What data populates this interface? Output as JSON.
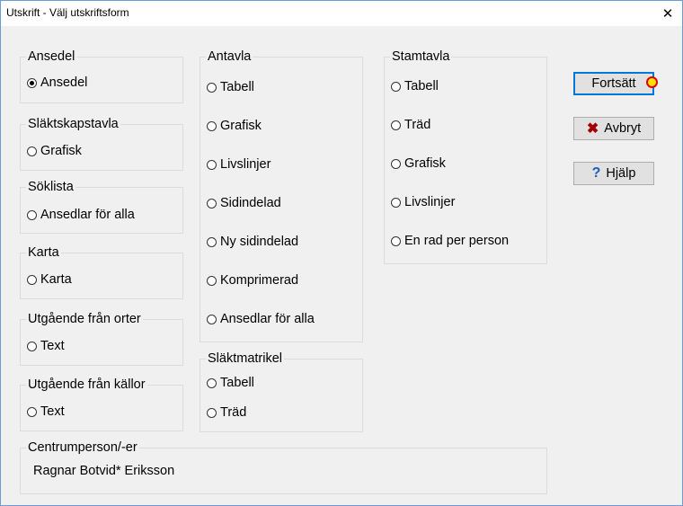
{
  "window": {
    "title": "Utskrift - Välj utskriftsform",
    "close_glyph": "✕"
  },
  "groups": {
    "ansedel": {
      "legend": "Ansedel",
      "options": [
        "Ansedel"
      ],
      "selected": "Ansedel"
    },
    "slaktskapstavla": {
      "legend": "Släktskapstavla",
      "options": [
        "Grafisk"
      ]
    },
    "soklista": {
      "legend": "Söklista",
      "options": [
        "Ansedlar för alla"
      ]
    },
    "karta": {
      "legend": "Karta",
      "options": [
        "Karta"
      ]
    },
    "orter": {
      "legend": "Utgående från orter",
      "options": [
        "Text"
      ]
    },
    "kallor": {
      "legend": "Utgående från källor",
      "options": [
        "Text"
      ]
    },
    "antavla": {
      "legend": "Antavla",
      "options": [
        "Tabell",
        "Grafisk",
        "Livslinjer",
        "Sidindelad",
        "Ny sidindelad",
        "Komprimerad",
        "Ansedlar för alla"
      ]
    },
    "slaktmatrikel": {
      "legend": "Släktmatrikel",
      "options": [
        "Tabell",
        "Träd"
      ]
    },
    "stamtavla": {
      "legend": "Stamtavla",
      "options": [
        "Tabell",
        "Träd",
        "Grafisk",
        "Livslinjer",
        "En rad per person"
      ]
    },
    "centrum": {
      "legend": "Centrumperson/-er",
      "value": "Ragnar Botvid* Eriksson"
    }
  },
  "buttons": {
    "continue": {
      "label": "Fortsätt"
    },
    "cancel": {
      "label": "Avbryt",
      "icon": "x-icon",
      "icon_glyph": "✖",
      "icon_color": "#a00000"
    },
    "help": {
      "label": "Hjälp",
      "icon": "question-icon",
      "icon_glyph": "?",
      "icon_color": "#1c5fb8"
    }
  },
  "colors": {
    "focus_border": "#0078d7",
    "indicator_fill": "#ffe000",
    "indicator_ring": "#e00000"
  }
}
